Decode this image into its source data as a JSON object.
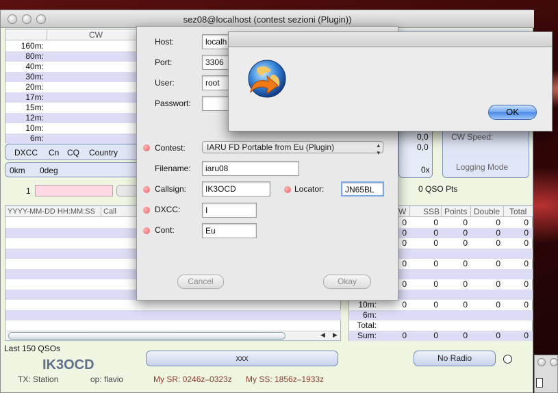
{
  "window": {
    "title": "sez08@localhost (contest sezioni (Plugin))"
  },
  "bands": {
    "header_col": "CW",
    "rows": [
      "160m:",
      "80m:",
      "40m:",
      "30m:",
      "20m:",
      "17m:",
      "15m:",
      "12m:",
      "10m:",
      "6m:"
    ]
  },
  "dxcc_bar": {
    "dxcc": "DXCC",
    "cn": "Cn",
    "cq": "CQ",
    "country": "Country"
  },
  "dist_bar": {
    "km": "0km",
    "deg": "0deg"
  },
  "entry": {
    "serial": "1"
  },
  "log_table": {
    "col_datetime": "YYYY-MM-DD HH:MM:SS",
    "col_call": "Call"
  },
  "stats": {
    "val1": "0,0",
    "val2": "0,0",
    "count": "0x",
    "cw_speed_label": "CW Speed:",
    "logging_mode_label": "Logging Mode",
    "qso_pts": "0 QSO Pts"
  },
  "summary": {
    "headers": [
      "W",
      "SSB",
      "Points",
      "Double",
      "Total"
    ],
    "rows": [
      {
        "label": "",
        "values": [
          "0",
          "0",
          "0",
          "0",
          "0"
        ]
      },
      {
        "label": "",
        "values": [
          "0",
          "0",
          "0",
          "0",
          "0"
        ]
      },
      {
        "label": "",
        "values": [
          "0",
          "0",
          "0",
          "0",
          "0"
        ]
      },
      {
        "label": "",
        "values": []
      },
      {
        "label": "",
        "values": [
          "0",
          "0",
          "0",
          "0",
          "0"
        ]
      },
      {
        "label": "",
        "values": []
      },
      {
        "label": "",
        "values": [
          "0",
          "0",
          "0",
          "0",
          "0"
        ]
      },
      {
        "label": "",
        "values": []
      },
      {
        "label": "10m:",
        "values": [
          "0",
          "0",
          "0",
          "0",
          "0"
        ]
      },
      {
        "label": "6m:",
        "values": []
      },
      {
        "label": "Total:",
        "values": []
      },
      {
        "label": "Sum:",
        "values": [
          "0",
          "0",
          "0",
          "0",
          "0"
        ]
      }
    ]
  },
  "status": {
    "last_qsos": "Last 150 QSOs",
    "callsign": "IK3OCD",
    "xxx_button": "xxx",
    "no_radio_button": "No Radio",
    "tx": "TX: Station",
    "op": "op: flavio",
    "my_sr": "My SR: 0246z–0323z",
    "my_ss": "My SS: 1856z–1933z"
  },
  "dialog": {
    "host_label": "Host:",
    "host_value": "localh",
    "port_label": "Port:",
    "port_value": "3306",
    "user_label": "User:",
    "user_value": "root",
    "password_label": "Passwort:",
    "password_value": "",
    "contest_label": "Contest:",
    "contest_value": "IARU FD Portable from Eu (Plugin)",
    "filename_label": "Filename:",
    "filename_value": "iaru08",
    "callsign_label": "Callsign:",
    "callsign_value": "IK3OCD",
    "locator_label": "Locator:",
    "locator_value": "JN65BL",
    "dxcc_label": "DXCC:",
    "dxcc_value": "I",
    "cont_label": "Cont:",
    "cont_value": "Eu",
    "cancel_label": "Cancel",
    "okay_label": "Okay"
  },
  "alert": {
    "ok_label": "OK",
    "icon": "network-update-icon"
  }
}
